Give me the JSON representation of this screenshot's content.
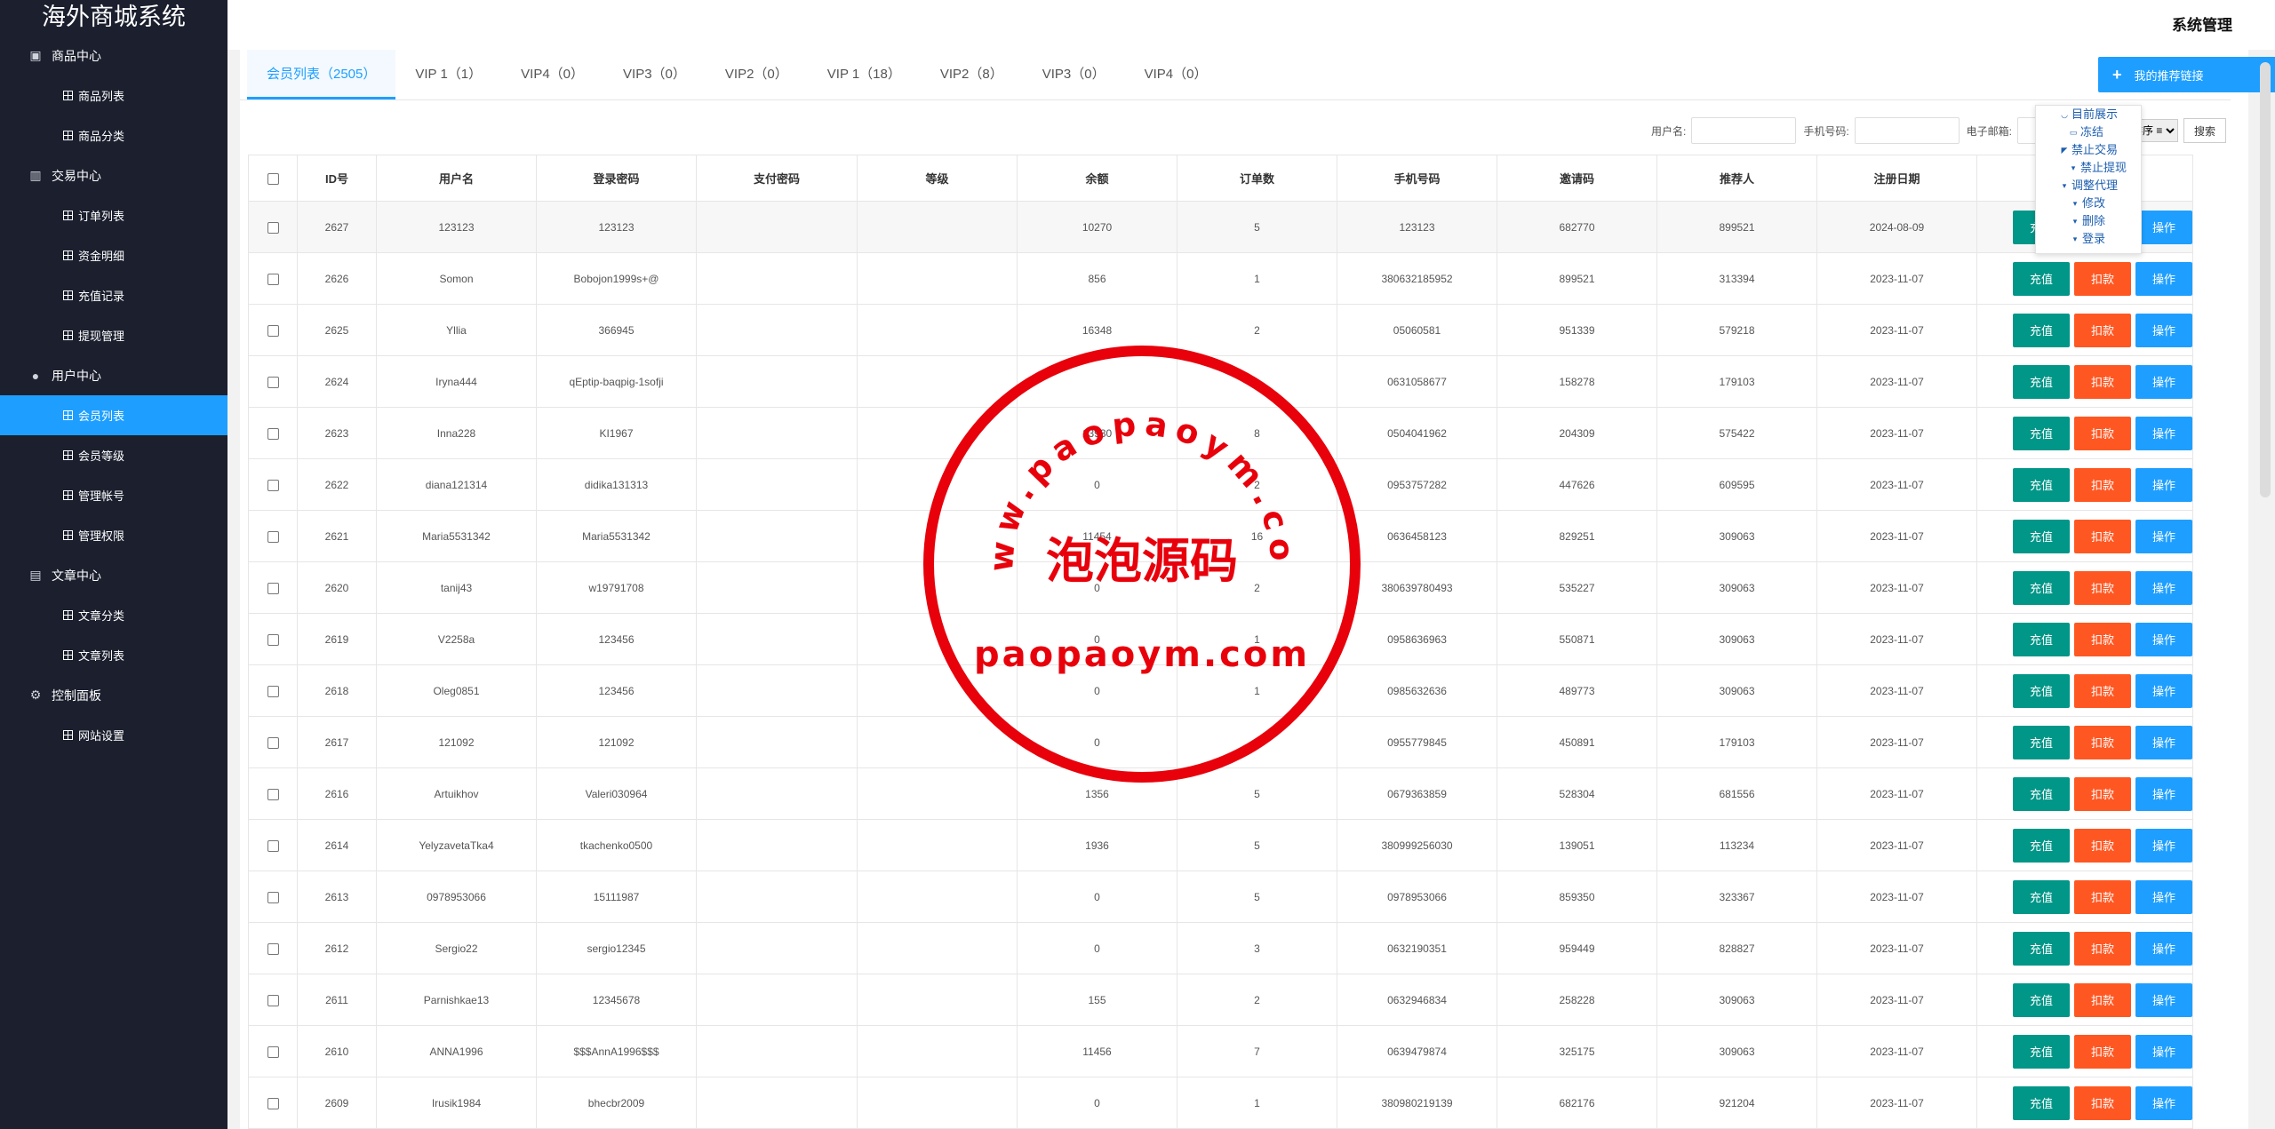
{
  "brand": "海外商城系统",
  "header": {
    "system_label": "系统管理"
  },
  "sidebar": {
    "groups": [
      {
        "label": "商品中心",
        "icon": "product-icon",
        "items": [
          "商品列表",
          "商品分类"
        ]
      },
      {
        "label": "交易中心",
        "icon": "chart-icon",
        "items": [
          "订单列表",
          "资金明细",
          "充值记录",
          "提现管理"
        ]
      },
      {
        "label": "用户中心",
        "icon": "user-icon",
        "items": [
          "会员列表",
          "会员等级",
          "管理帐号",
          "管理权限"
        ]
      },
      {
        "label": "文章中心",
        "icon": "article-icon",
        "items": [
          "文章分类",
          "文章列表"
        ]
      },
      {
        "label": "控制面板",
        "icon": "gear-icon",
        "items": [
          "网站设置"
        ]
      }
    ],
    "active_item": "会员列表"
  },
  "tabs": [
    "会员列表（2505）",
    "VIP 1（1）",
    "VIP4（0）",
    "VIP3（0）",
    "VIP2（0）",
    "VIP 1（18）",
    "VIP2（8）",
    "VIP3（0）",
    "VIP4（0）"
  ],
  "recommend_button": "我的推荐链接",
  "search": {
    "username_label": "用户名:",
    "phone_label": "手机号码:",
    "email_label": "电子邮箱:",
    "sort_value": "排序 ≡",
    "search_button": "搜索"
  },
  "table": {
    "headers": [
      "ID号",
      "用户名",
      "登录密码",
      "支付密码",
      "等级",
      "余额",
      "订单数",
      "手机号码",
      "邀请码",
      "推荐人",
      "注册日期",
      ""
    ],
    "buttons": {
      "recharge": "充值",
      "deduct": "扣款",
      "operate": "操作"
    },
    "rows": [
      [
        "2627",
        "123123",
        "123123",
        "",
        "",
        "10270",
        "5",
        "123123",
        "682770",
        "899521",
        "2024-08-09"
      ],
      [
        "2626",
        "Somon",
        "Bobojon1999s+@",
        "",
        "",
        "856",
        "1",
        "380632185952",
        "899521",
        "313394",
        "2023-11-07"
      ],
      [
        "2625",
        "Yllia",
        "366945",
        "",
        "",
        "16348",
        "2",
        "05060581",
        "951339",
        "579218",
        "2023-11-07"
      ],
      [
        "2624",
        "Iryna444",
        "qEptip-baqpig-1sofji",
        "",
        "",
        "",
        "",
        "0631058677",
        "158278",
        "179103",
        "2023-11-07"
      ],
      [
        "2623",
        "Inna228",
        "KI1967",
        "",
        "",
        "13930",
        "8",
        "0504041962",
        "204309",
        "575422",
        "2023-11-07"
      ],
      [
        "2622",
        "diana121314",
        "didika131313",
        "",
        "",
        "0",
        "2",
        "0953757282",
        "447626",
        "609595",
        "2023-11-07"
      ],
      [
        "2621",
        "Maria5531342",
        "Maria5531342",
        "",
        "",
        "11454",
        "16",
        "0636458123",
        "829251",
        "309063",
        "2023-11-07"
      ],
      [
        "2620",
        "tanij43",
        "w19791708",
        "",
        "",
        "0",
        "2",
        "380639780493",
        "535227",
        "309063",
        "2023-11-07"
      ],
      [
        "2619",
        "V2258a",
        "123456",
        "",
        "",
        "0",
        "1",
        "0958636963",
        "550871",
        "309063",
        "2023-11-07"
      ],
      [
        "2618",
        "Oleg0851",
        "123456",
        "",
        "",
        "0",
        "1",
        "0985632636",
        "489773",
        "309063",
        "2023-11-07"
      ],
      [
        "2617",
        "121092",
        "121092",
        "",
        "",
        "0",
        "5",
        "0955779845",
        "450891",
        "179103",
        "2023-11-07"
      ],
      [
        "2616",
        "Artuikhov",
        "Valeri030964",
        "",
        "",
        "1356",
        "5",
        "0679363859",
        "528304",
        "681556",
        "2023-11-07"
      ],
      [
        "2614",
        "YelyzavetaTka4",
        "tkachenko0500",
        "",
        "",
        "1936",
        "5",
        "380999256030",
        "139051",
        "113234",
        "2023-11-07"
      ],
      [
        "2613",
        "0978953066",
        "15111987",
        "",
        "",
        "0",
        "5",
        "0978953066",
        "859350",
        "323367",
        "2023-11-07"
      ],
      [
        "2612",
        "Sergio22",
        "sergio12345",
        "",
        "",
        "0",
        "3",
        "0632190351",
        "959449",
        "828827",
        "2023-11-07"
      ],
      [
        "2611",
        "Parnishkae13",
        "12345678",
        "",
        "",
        "155",
        "2",
        "0632946834",
        "258228",
        "309063",
        "2023-11-07"
      ],
      [
        "2610",
        "ANNA1996",
        "$$$AnnA1996$$$",
        "",
        "",
        "11456",
        "7",
        "0639479874",
        "325175",
        "309063",
        "2023-11-07"
      ],
      [
        "2609",
        "Irusik1984",
        "bhecbr2009",
        "",
        "",
        "0",
        "1",
        "380980219139",
        "682176",
        "921204",
        "2023-11-07"
      ]
    ]
  },
  "popup_menu": [
    "目前展示",
    "冻结",
    "禁止交易",
    "禁止提现",
    "调整代理",
    "修改",
    "删除",
    "登录"
  ],
  "watermark": {
    "ring_text": "www.paopaoym.com",
    "center_text": "泡泡源码",
    "bottom_text": "paopaoym.com",
    "color": "#e8000b"
  },
  "colors": {
    "accent": "#1e9fff",
    "recharge": "#009688",
    "deduct": "#ff5722",
    "sidebar": "#1b1f2e"
  }
}
